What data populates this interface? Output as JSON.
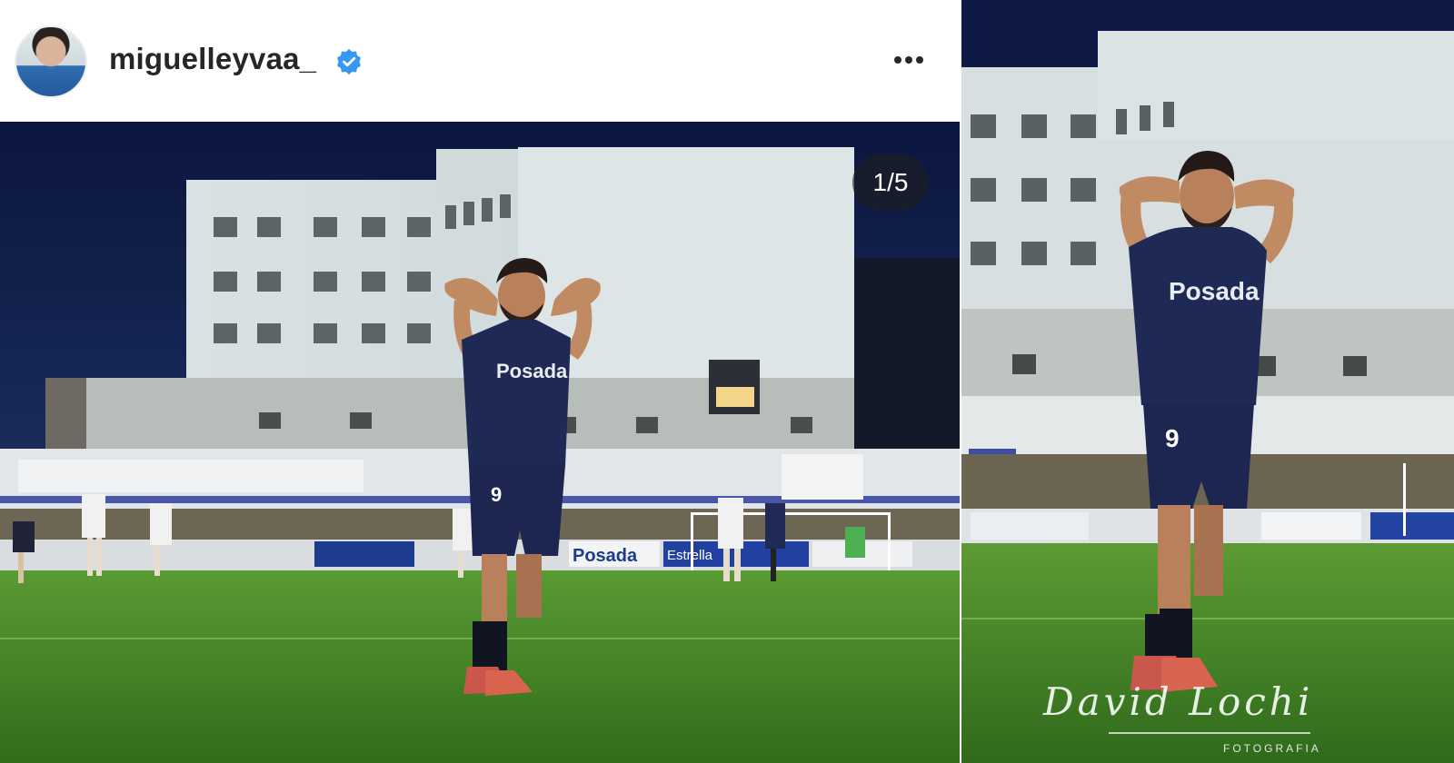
{
  "post": {
    "username": "miguelleyvaa_",
    "verified": true,
    "more_icon": "more-horizontal-icon",
    "carousel_counter": "1/5"
  },
  "photo": {
    "jersey_sponsor": "Posada",
    "jersey_number": "9",
    "board_texts": [
      "Posada",
      "Estrella"
    ]
  },
  "watermark": {
    "signature": "David Lochi",
    "subtitle": "FOTOGRAFIA"
  },
  "colors": {
    "verified_blue": "#3897f0",
    "sky_navy": "#0e1a45",
    "pitch_green": "#4c8f2a",
    "kit_navy": "#1e2a55"
  }
}
